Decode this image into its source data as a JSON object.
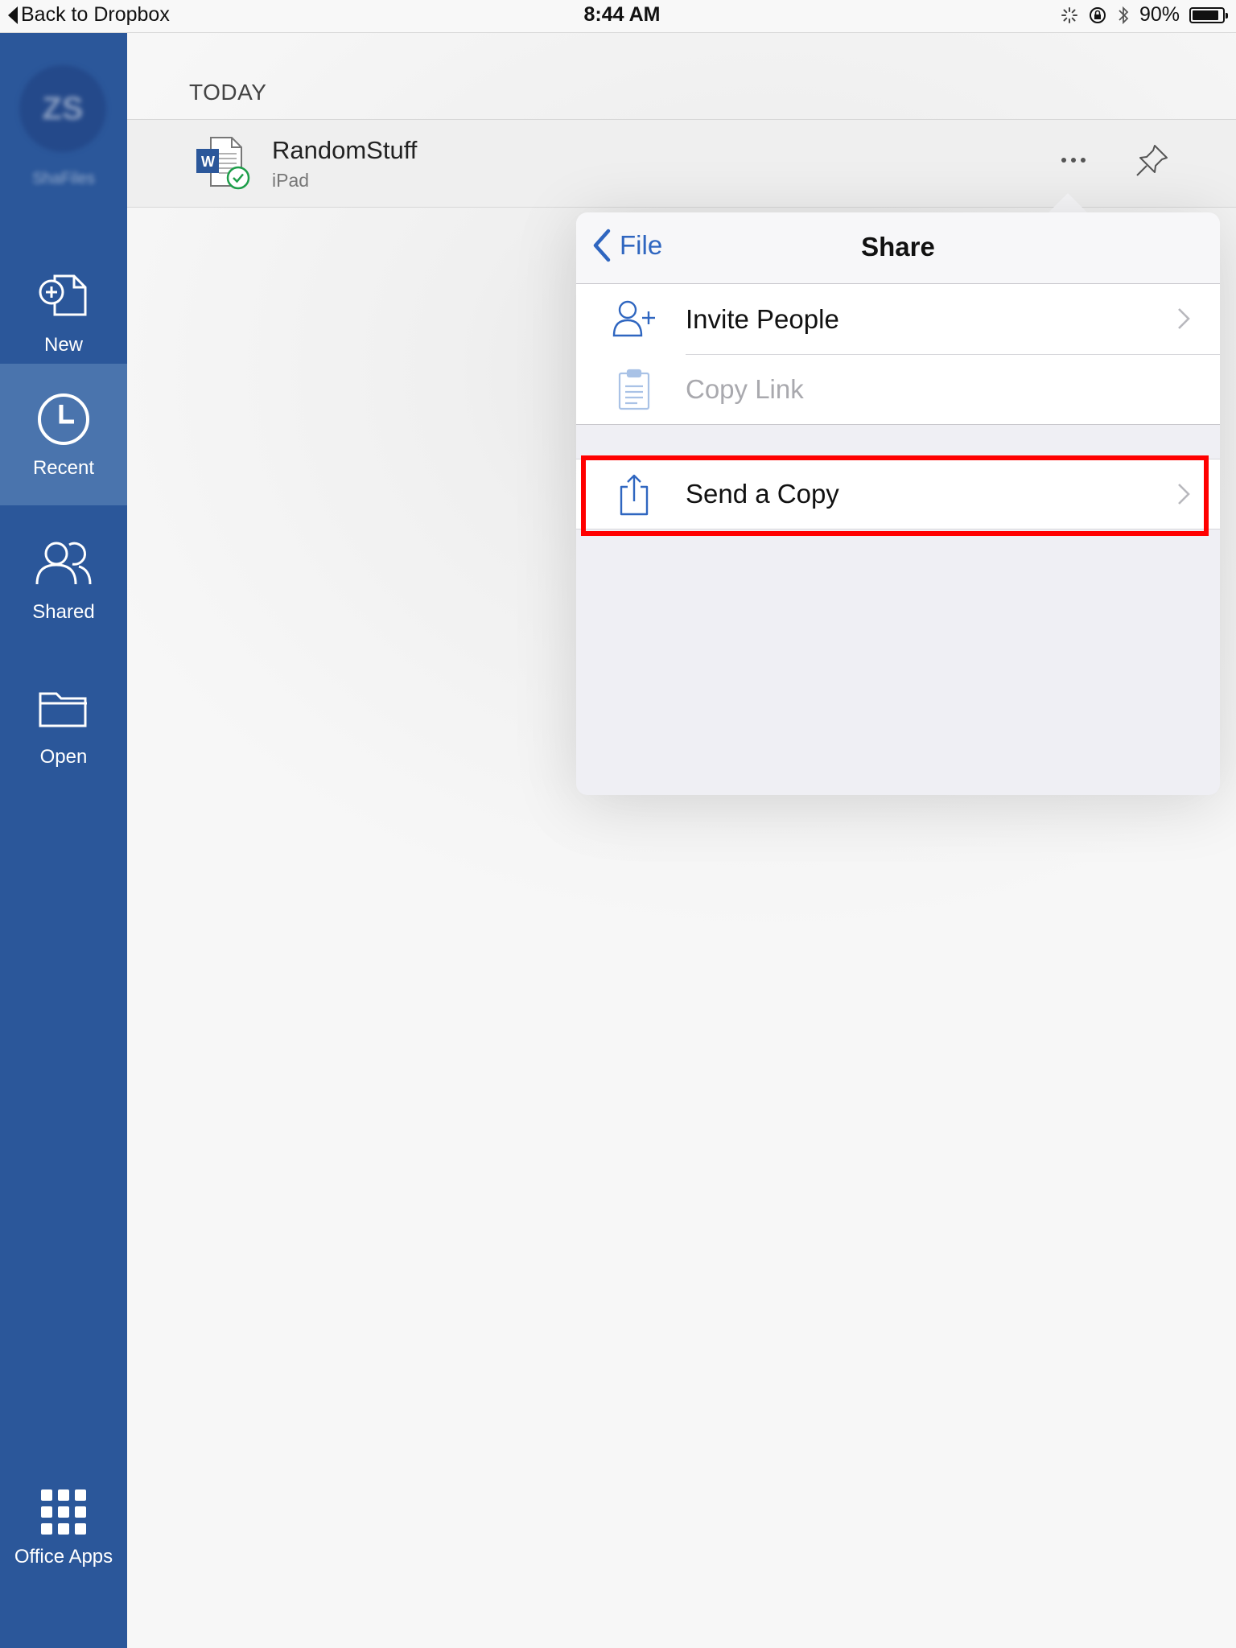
{
  "status_bar": {
    "back_label": "Back to Dropbox",
    "time": "8:44 AM",
    "battery_percent": "90%",
    "battery_level": 0.9
  },
  "sidebar": {
    "avatar_initials": "ZS",
    "account_name": "ShaFiles",
    "items": [
      {
        "label": "New",
        "icon": "new-document-icon",
        "active": false
      },
      {
        "label": "Recent",
        "icon": "clock-icon",
        "active": true
      },
      {
        "label": "Shared",
        "icon": "people-icon",
        "active": false
      },
      {
        "label": "Open",
        "icon": "folder-icon",
        "active": false
      }
    ],
    "office_apps_label": "Office Apps",
    "accent_color": "#2b579a"
  },
  "main": {
    "section_header": "TODAY",
    "file": {
      "name": "RandomStuff",
      "location": "iPad",
      "icon": "word-document-icon"
    }
  },
  "popover": {
    "back_label": "File",
    "title": "Share",
    "items": [
      {
        "label": "Invite People",
        "icon": "add-person-icon",
        "enabled": true,
        "has_chevron": true
      },
      {
        "label": "Copy Link",
        "icon": "clipboard-icon",
        "enabled": false,
        "has_chevron": false
      },
      {
        "label": "Send a Copy",
        "icon": "share-icon",
        "enabled": true,
        "has_chevron": true
      }
    ],
    "link_color": "#2f66c0",
    "highlight_color": "#ff0000"
  }
}
